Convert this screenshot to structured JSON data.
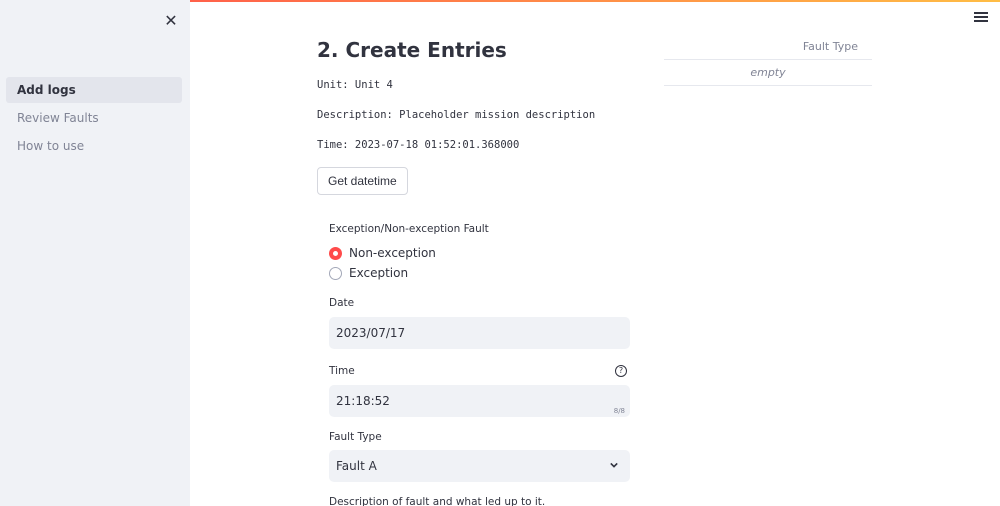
{
  "sidebar": {
    "close_glyph": "✕",
    "items": [
      {
        "label": "Add logs",
        "active": true
      },
      {
        "label": "Review Faults",
        "active": false
      },
      {
        "label": "How to use",
        "active": false
      }
    ]
  },
  "main": {
    "title": "2. Create Entries",
    "unit_line": "Unit: Unit 4",
    "description_line": "Description: Placeholder mission description",
    "time_line": "Time: 2023-07-18 01:52:01.368000",
    "get_datetime_button": "Get datetime",
    "fault_kind": {
      "label": "Exception/Non-exception Fault",
      "options": [
        {
          "label": "Non-exception",
          "selected": true
        },
        {
          "label": "Exception",
          "selected": false
        }
      ]
    },
    "date": {
      "label": "Date",
      "value": "2023/07/17"
    },
    "time": {
      "label": "Time",
      "value": "21:18:52",
      "counter": "8/8",
      "help_glyph": "?"
    },
    "fault_type": {
      "label": "Fault Type",
      "value": "Fault A"
    },
    "description_label": "Description of fault and what led up to it."
  },
  "table": {
    "header": "Fault Type",
    "empty_text": "empty"
  },
  "colors": {
    "accent": "#ff4b4b",
    "sidebar_bg": "#f0f2f6",
    "input_bg": "#f0f2f6",
    "text": "#31333f",
    "muted": "#808495"
  }
}
